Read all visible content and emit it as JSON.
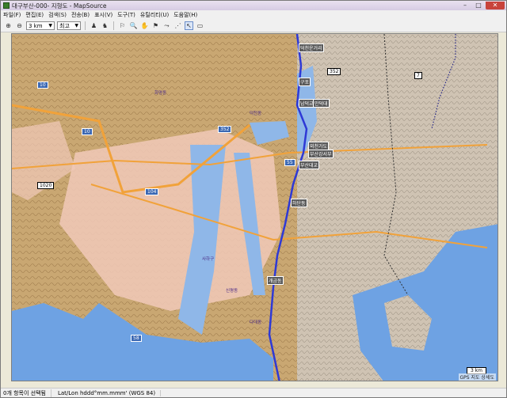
{
  "window": {
    "title": "대구부산-000- 지형도 - MapSource",
    "min": "–",
    "max": "□",
    "close": "✕"
  },
  "menu": [
    "파일(F)",
    "편집(E)",
    "검색(S)",
    "전송(B)",
    "표시(V)",
    "도구(T)",
    "유틸리티(U)",
    "도움말(H)"
  ],
  "toolbar": {
    "zoom_in_icon": "zoom-in-icon",
    "zoom_out_icon": "zoom-out-icon",
    "scale_value": "3 km",
    "detail_value": "최고",
    "tools": [
      "select-icon",
      "zoom-tool-icon",
      "hand-icon",
      "waypoint-flag-icon",
      "route-tool-icon",
      "track-tool-icon",
      "measure-icon"
    ]
  },
  "map": {
    "road_labels": [
      {
        "text": "10",
        "kind": "blue"
      },
      {
        "text": "10",
        "kind": "blue"
      },
      {
        "text": "104",
        "kind": "blue"
      },
      {
        "text": "1020",
        "kind": "white"
      },
      {
        "text": "352",
        "kind": "blue"
      },
      {
        "text": "55",
        "kind": "blue"
      },
      {
        "text": "7",
        "kind": "white"
      },
      {
        "text": "352",
        "kind": "white"
      },
      {
        "text": "58",
        "kind": "blue"
      }
    ],
    "waypoints": [
      "덕천운거리",
      "구포",
      "남덕교",
      "만덕대",
      "외천가도",
      "부산강서부",
      "부산대교",
      "하단동",
      "개금동",
      "화명동",
      "덕천동",
      "신평동",
      "다대동",
      "사하구"
    ],
    "scale_text": "3 km",
    "credit_text": "GPS 지도 상세도"
  },
  "status": {
    "selection": "0개 항목이 선택됨",
    "coords": "Lat/Lon hddd°mm.mmm' (WGS 84)"
  }
}
